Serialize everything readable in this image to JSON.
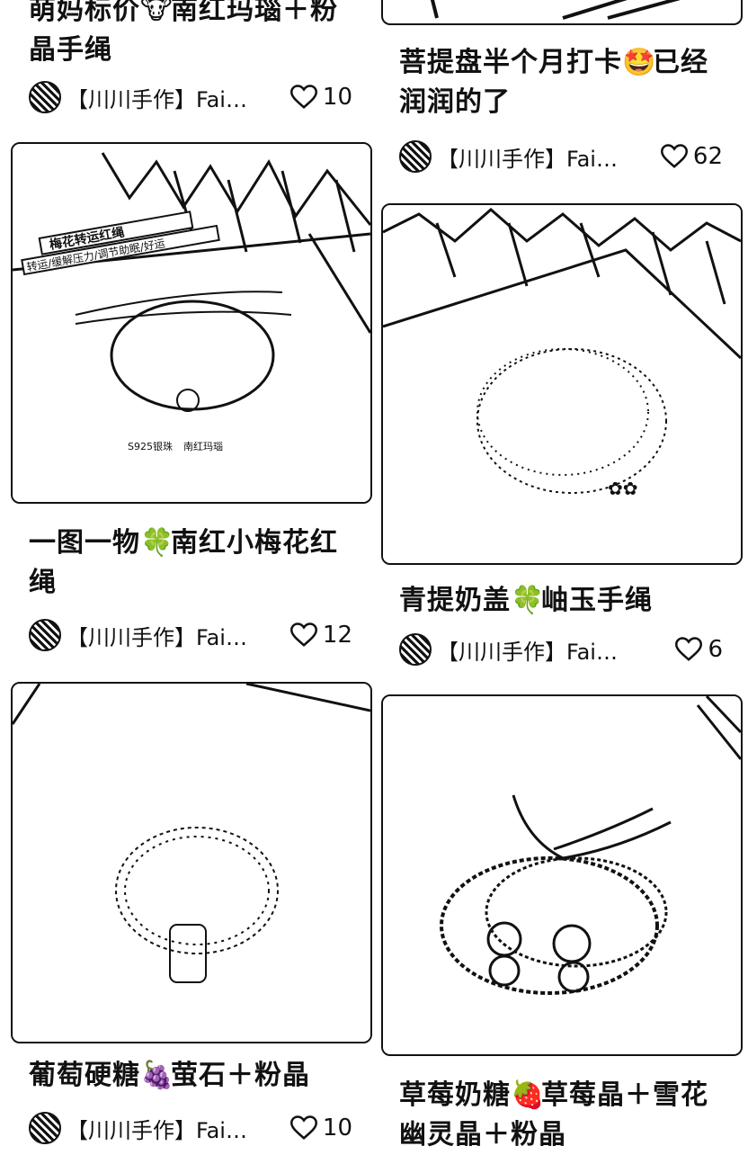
{
  "feed": {
    "left": [
      {
        "title_a": "萌妈标价",
        "title_emo": "🐮",
        "title_b": "南红玛瑙＋粉晶手绳",
        "author": "【川川手作】Fairy...",
        "likes": "10"
      },
      {
        "badge_text": "梅花转运红绳",
        "badge_sub": "转运/缓解压力/调节助眠/好运",
        "tag1": "S925银珠",
        "tag2": "南红玛瑙",
        "title_a": "一图一物",
        "title_emo": "🍀",
        "title_b": "南红小梅花红绳",
        "author": "【川川手作】Fairy...",
        "likes": "12"
      },
      {
        "title_a": "葡萄硬糖",
        "title_emo": "🍇",
        "title_b": "萤石＋粉晶",
        "author": "【川川手作】Fairy...",
        "likes": "10"
      }
    ],
    "right": [
      {
        "title_a": "菩提盘半个月打卡",
        "title_emo": "🤩",
        "title_b": "已经润润的了",
        "author": "【川川手作】Fairy...",
        "likes": "62"
      },
      {
        "title_a": "青提奶盖",
        "title_emo": "🍀",
        "title_b": "岫玉手绳",
        "author": "【川川手作】Fairy h...",
        "likes": "6"
      },
      {
        "title_a": "草莓奶糖",
        "title_emo": "🍓",
        "title_b": "草莓晶＋雪花幽灵晶＋粉晶",
        "author": "",
        "likes": ""
      }
    ]
  }
}
